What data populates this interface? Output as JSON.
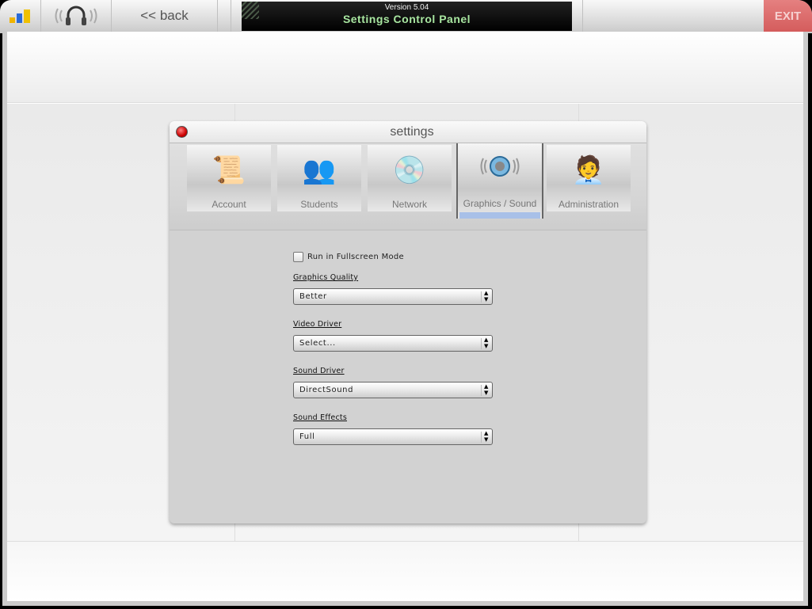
{
  "topbar": {
    "back_label": "<< back",
    "version": "Version 5.04",
    "title": "Settings Control Panel",
    "exit_label": "EXIT",
    "icons": [
      "stats-bars-icon",
      "headphones-icon"
    ]
  },
  "dialog": {
    "title": "settings",
    "tabs": [
      {
        "label": "Account",
        "icon": "scroll-icon",
        "active": false
      },
      {
        "label": "Students",
        "icon": "students-icon",
        "active": false
      },
      {
        "label": "Network",
        "icon": "network-drive-icon",
        "active": false
      },
      {
        "label": "Graphics / Sound",
        "icon": "speaker-icon",
        "active": true
      },
      {
        "label": "Administration",
        "icon": "admin-person-icon",
        "active": false
      }
    ],
    "fullscreen": {
      "label": "Run in Fullscreen Mode",
      "checked": false
    },
    "fields": [
      {
        "label": "Graphics Quality",
        "value": "Better"
      },
      {
        "label": "Video Driver",
        "value": "Select..."
      },
      {
        "label": "Sound Driver",
        "value": "DirectSound"
      },
      {
        "label": "Sound Effects",
        "value": "Full"
      }
    ]
  },
  "colors": {
    "accent_tab": "#a8c0e8",
    "exit": "#d45c5c",
    "title_green": "#a8e6a0"
  }
}
